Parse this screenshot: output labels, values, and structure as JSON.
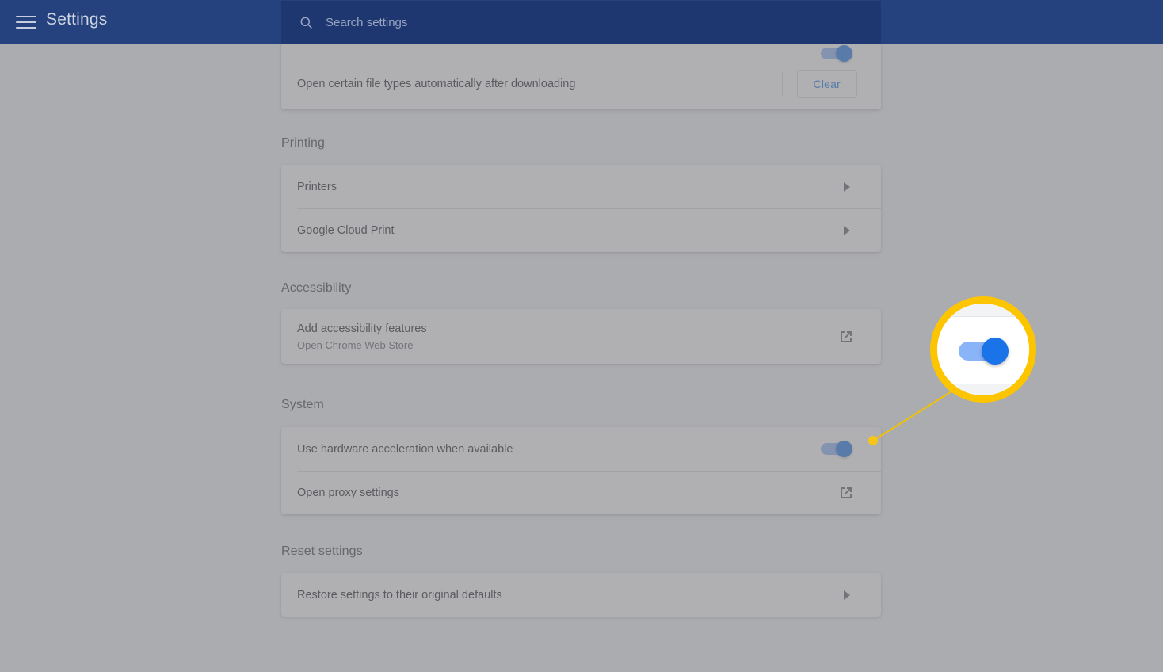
{
  "appbar": {
    "menu_icon": "hamburger-menu-icon",
    "title": "Settings",
    "search_icon": "search-icon",
    "search_placeholder": "Search settings",
    "search_value": "",
    "bg_color": "#25417e",
    "search_bg_color": "#1f3770"
  },
  "downloads_card": {
    "rows": [
      {
        "label": "Open certain file types automatically after downloading",
        "action_label": "Clear"
      }
    ]
  },
  "sections": [
    {
      "title": "Printing",
      "rows": [
        {
          "label": "Printers",
          "sub": "",
          "control": "arrow"
        },
        {
          "label": "Google Cloud Print",
          "sub": "",
          "control": "arrow"
        }
      ]
    },
    {
      "title": "Accessibility",
      "rows": [
        {
          "label": "Add accessibility features",
          "sub": "Open Chrome Web Store",
          "control": "external-link"
        }
      ]
    },
    {
      "title": "System",
      "rows": [
        {
          "label": "Use hardware acceleration when available",
          "sub": "",
          "control": "toggle",
          "toggle_on": true
        },
        {
          "label": "Open proxy settings",
          "sub": "",
          "control": "external-link"
        }
      ]
    },
    {
      "title": "Reset settings",
      "rows": [
        {
          "label": "Restore settings to their original defaults",
          "sub": "",
          "control": "arrow"
        }
      ]
    }
  ],
  "callout": {
    "name": "hardware-acceleration-toggle-magnifier",
    "ring_color": "#fdc500",
    "dot_color": "#f5c518",
    "line_color": "#f2c200",
    "toggle_track_color": "#8ab4f8",
    "toggle_knob_color": "#1a73e8",
    "toggle_state": "on"
  },
  "overlay": {
    "dim_color": "#808085",
    "dim_opacity": "0.62"
  }
}
